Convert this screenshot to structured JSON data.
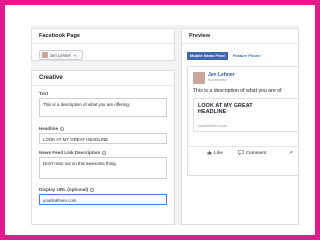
{
  "facebook_page": {
    "title": "Facebook Page",
    "selected_page": "Jen Lehner"
  },
  "creative": {
    "title": "Creative",
    "text_label": "Text",
    "text_value": "This is a description of what you are offering.",
    "headline_label": "Headline",
    "headline_value": "LOOK AT MY GREAT HEADLINE",
    "link_desc_label": "News Feed Link Description",
    "link_desc_value": "Don't miss out on this awesome thing.",
    "display_url_label": "Display URL (optional)",
    "display_url_value": "yourlinkhere.com"
  },
  "preview": {
    "title": "Preview",
    "tabs": [
      {
        "label": "Mobile News Feed",
        "active": true
      },
      {
        "label": "Feature Phone",
        "active": false
      }
    ],
    "post": {
      "name": "Jen Lehner",
      "sponsored": "Sponsored",
      "text": "This is a description of what you are of",
      "headline": "LOOK AT MY GREAT HEADLINE",
      "url": "yourlinkhere.com",
      "actions": {
        "like": "Like",
        "comment": "Comment",
        "share": "↗"
      }
    }
  },
  "colors": {
    "frame_border": "#e11a8d",
    "accent": "#4267b2",
    "focus_border": "#4080ff"
  }
}
